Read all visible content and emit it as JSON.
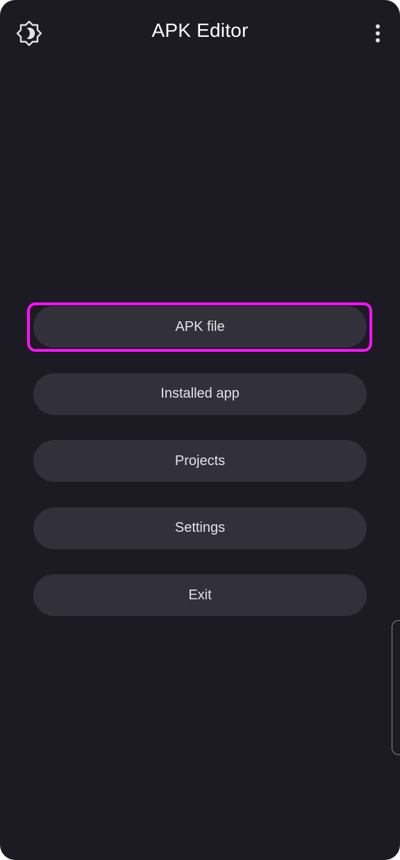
{
  "app": {
    "title": "APK Editor"
  },
  "topbar": {
    "left_icon": "brightness-icon",
    "right_icon": "more-vert-icon"
  },
  "menu": {
    "items": [
      {
        "label": "APK file",
        "highlighted": true
      },
      {
        "label": "Installed app"
      },
      {
        "label": "Projects"
      },
      {
        "label": "Settings"
      },
      {
        "label": "Exit"
      }
    ]
  },
  "colors": {
    "background": "#1c1b23",
    "button": "#32303b",
    "highlight": "#ff10ff",
    "text": "#ffffff"
  }
}
